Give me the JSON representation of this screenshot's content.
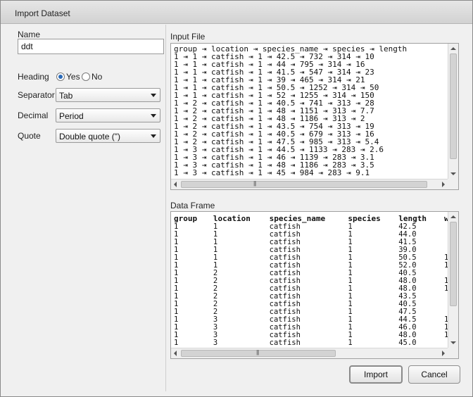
{
  "dialog": {
    "title": "Import Dataset"
  },
  "options": {
    "name_label": "Name",
    "name_value": "ddt",
    "heading_label": "Heading",
    "heading_yes": "Yes",
    "heading_no": "No",
    "heading_selected": "Yes",
    "separator_label": "Separator",
    "separator_value": "Tab",
    "decimal_label": "Decimal",
    "decimal_value": "Period",
    "quote_label": "Quote",
    "quote_value": "Double quote (\")"
  },
  "input_file": {
    "label": "Input File",
    "lines": [
      "group ⇥ location ⇥ species_name ⇥ species ⇥ length",
      "1 ⇥ 1 ⇥ catfish ⇥ 1 ⇥ 42.5 ⇥ 732 ⇥ 314 ⇥ 10",
      "1 ⇥ 1 ⇥ catfish ⇥ 1 ⇥ 44 ⇥ 795 ⇥ 314 ⇥ 16",
      "1 ⇥ 1 ⇥ catfish ⇥ 1 ⇥ 41.5 ⇥ 547 ⇥ 314 ⇥ 23",
      "1 ⇥ 1 ⇥ catfish ⇥ 1 ⇥ 39 ⇥ 465 ⇥ 314 ⇥ 21",
      "1 ⇥ 1 ⇥ catfish ⇥ 1 ⇥ 50.5 ⇥ 1252 ⇥ 314 ⇥ 50",
      "1 ⇥ 1 ⇥ catfish ⇥ 1 ⇥ 52 ⇥ 1255 ⇥ 314 ⇥ 150",
      "1 ⇥ 2 ⇥ catfish ⇥ 1 ⇥ 40.5 ⇥ 741 ⇥ 313 ⇥ 28",
      "1 ⇥ 2 ⇥ catfish ⇥ 1 ⇥ 48 ⇥ 1151 ⇥ 313 ⇥ 7.7",
      "1 ⇥ 2 ⇥ catfish ⇥ 1 ⇥ 48 ⇥ 1186 ⇥ 313 ⇥ 2",
      "1 ⇥ 2 ⇥ catfish ⇥ 1 ⇥ 43.5 ⇥ 754 ⇥ 313 ⇥ 19",
      "1 ⇥ 2 ⇥ catfish ⇥ 1 ⇥ 40.5 ⇥ 679 ⇥ 313 ⇥ 16",
      "1 ⇥ 2 ⇥ catfish ⇥ 1 ⇥ 47.5 ⇥ 985 ⇥ 313 ⇥ 5.4",
      "1 ⇥ 3 ⇥ catfish ⇥ 1 ⇥ 44.5 ⇥ 1133 ⇥ 283 ⇥ 2.6",
      "1 ⇥ 3 ⇥ catfish ⇥ 1 ⇥ 46 ⇥ 1139 ⇥ 283 ⇥ 3.1",
      "1 ⇥ 3 ⇥ catfish ⇥ 1 ⇥ 48 ⇥ 1186 ⇥ 283 ⇥ 3.5",
      "1 ⇥ 3 ⇥ catfish ⇥ 1 ⇥ 45 ⇥ 984 ⇥ 283 ⇥ 9.1"
    ]
  },
  "data_frame": {
    "label": "Data Frame",
    "columns": [
      "group",
      "location",
      "species_name",
      "species",
      "length",
      "w"
    ],
    "rows": [
      [
        "1",
        "1",
        "catfish",
        "1",
        "42.5",
        ""
      ],
      [
        "1",
        "1",
        "catfish",
        "1",
        "44.0",
        ""
      ],
      [
        "1",
        "1",
        "catfish",
        "1",
        "41.5",
        ""
      ],
      [
        "1",
        "1",
        "catfish",
        "1",
        "39.0",
        ""
      ],
      [
        "1",
        "1",
        "catfish",
        "1",
        "50.5",
        "1"
      ],
      [
        "1",
        "1",
        "catfish",
        "1",
        "52.0",
        "1"
      ],
      [
        "1",
        "2",
        "catfish",
        "1",
        "40.5",
        ""
      ],
      [
        "1",
        "2",
        "catfish",
        "1",
        "48.0",
        "1"
      ],
      [
        "1",
        "2",
        "catfish",
        "1",
        "48.0",
        "1"
      ],
      [
        "1",
        "2",
        "catfish",
        "1",
        "43.5",
        ""
      ],
      [
        "1",
        "2",
        "catfish",
        "1",
        "40.5",
        ""
      ],
      [
        "1",
        "2",
        "catfish",
        "1",
        "47.5",
        ""
      ],
      [
        "1",
        "3",
        "catfish",
        "1",
        "44.5",
        "1"
      ],
      [
        "1",
        "3",
        "catfish",
        "1",
        "46.0",
        "1"
      ],
      [
        "1",
        "3",
        "catfish",
        "1",
        "48.0",
        "1"
      ],
      [
        "1",
        "3",
        "catfish",
        "1",
        "45.0",
        ""
      ]
    ]
  },
  "buttons": {
    "import": "Import",
    "cancel": "Cancel"
  },
  "icons": {
    "radio": "radio-button",
    "dropdown": "chevron-down",
    "scroll_left": "arrow-left",
    "scroll_right": "arrow-right",
    "scroll_up": "arrow-up",
    "scroll_down": "arrow-down",
    "grip": "scroll-grip"
  }
}
